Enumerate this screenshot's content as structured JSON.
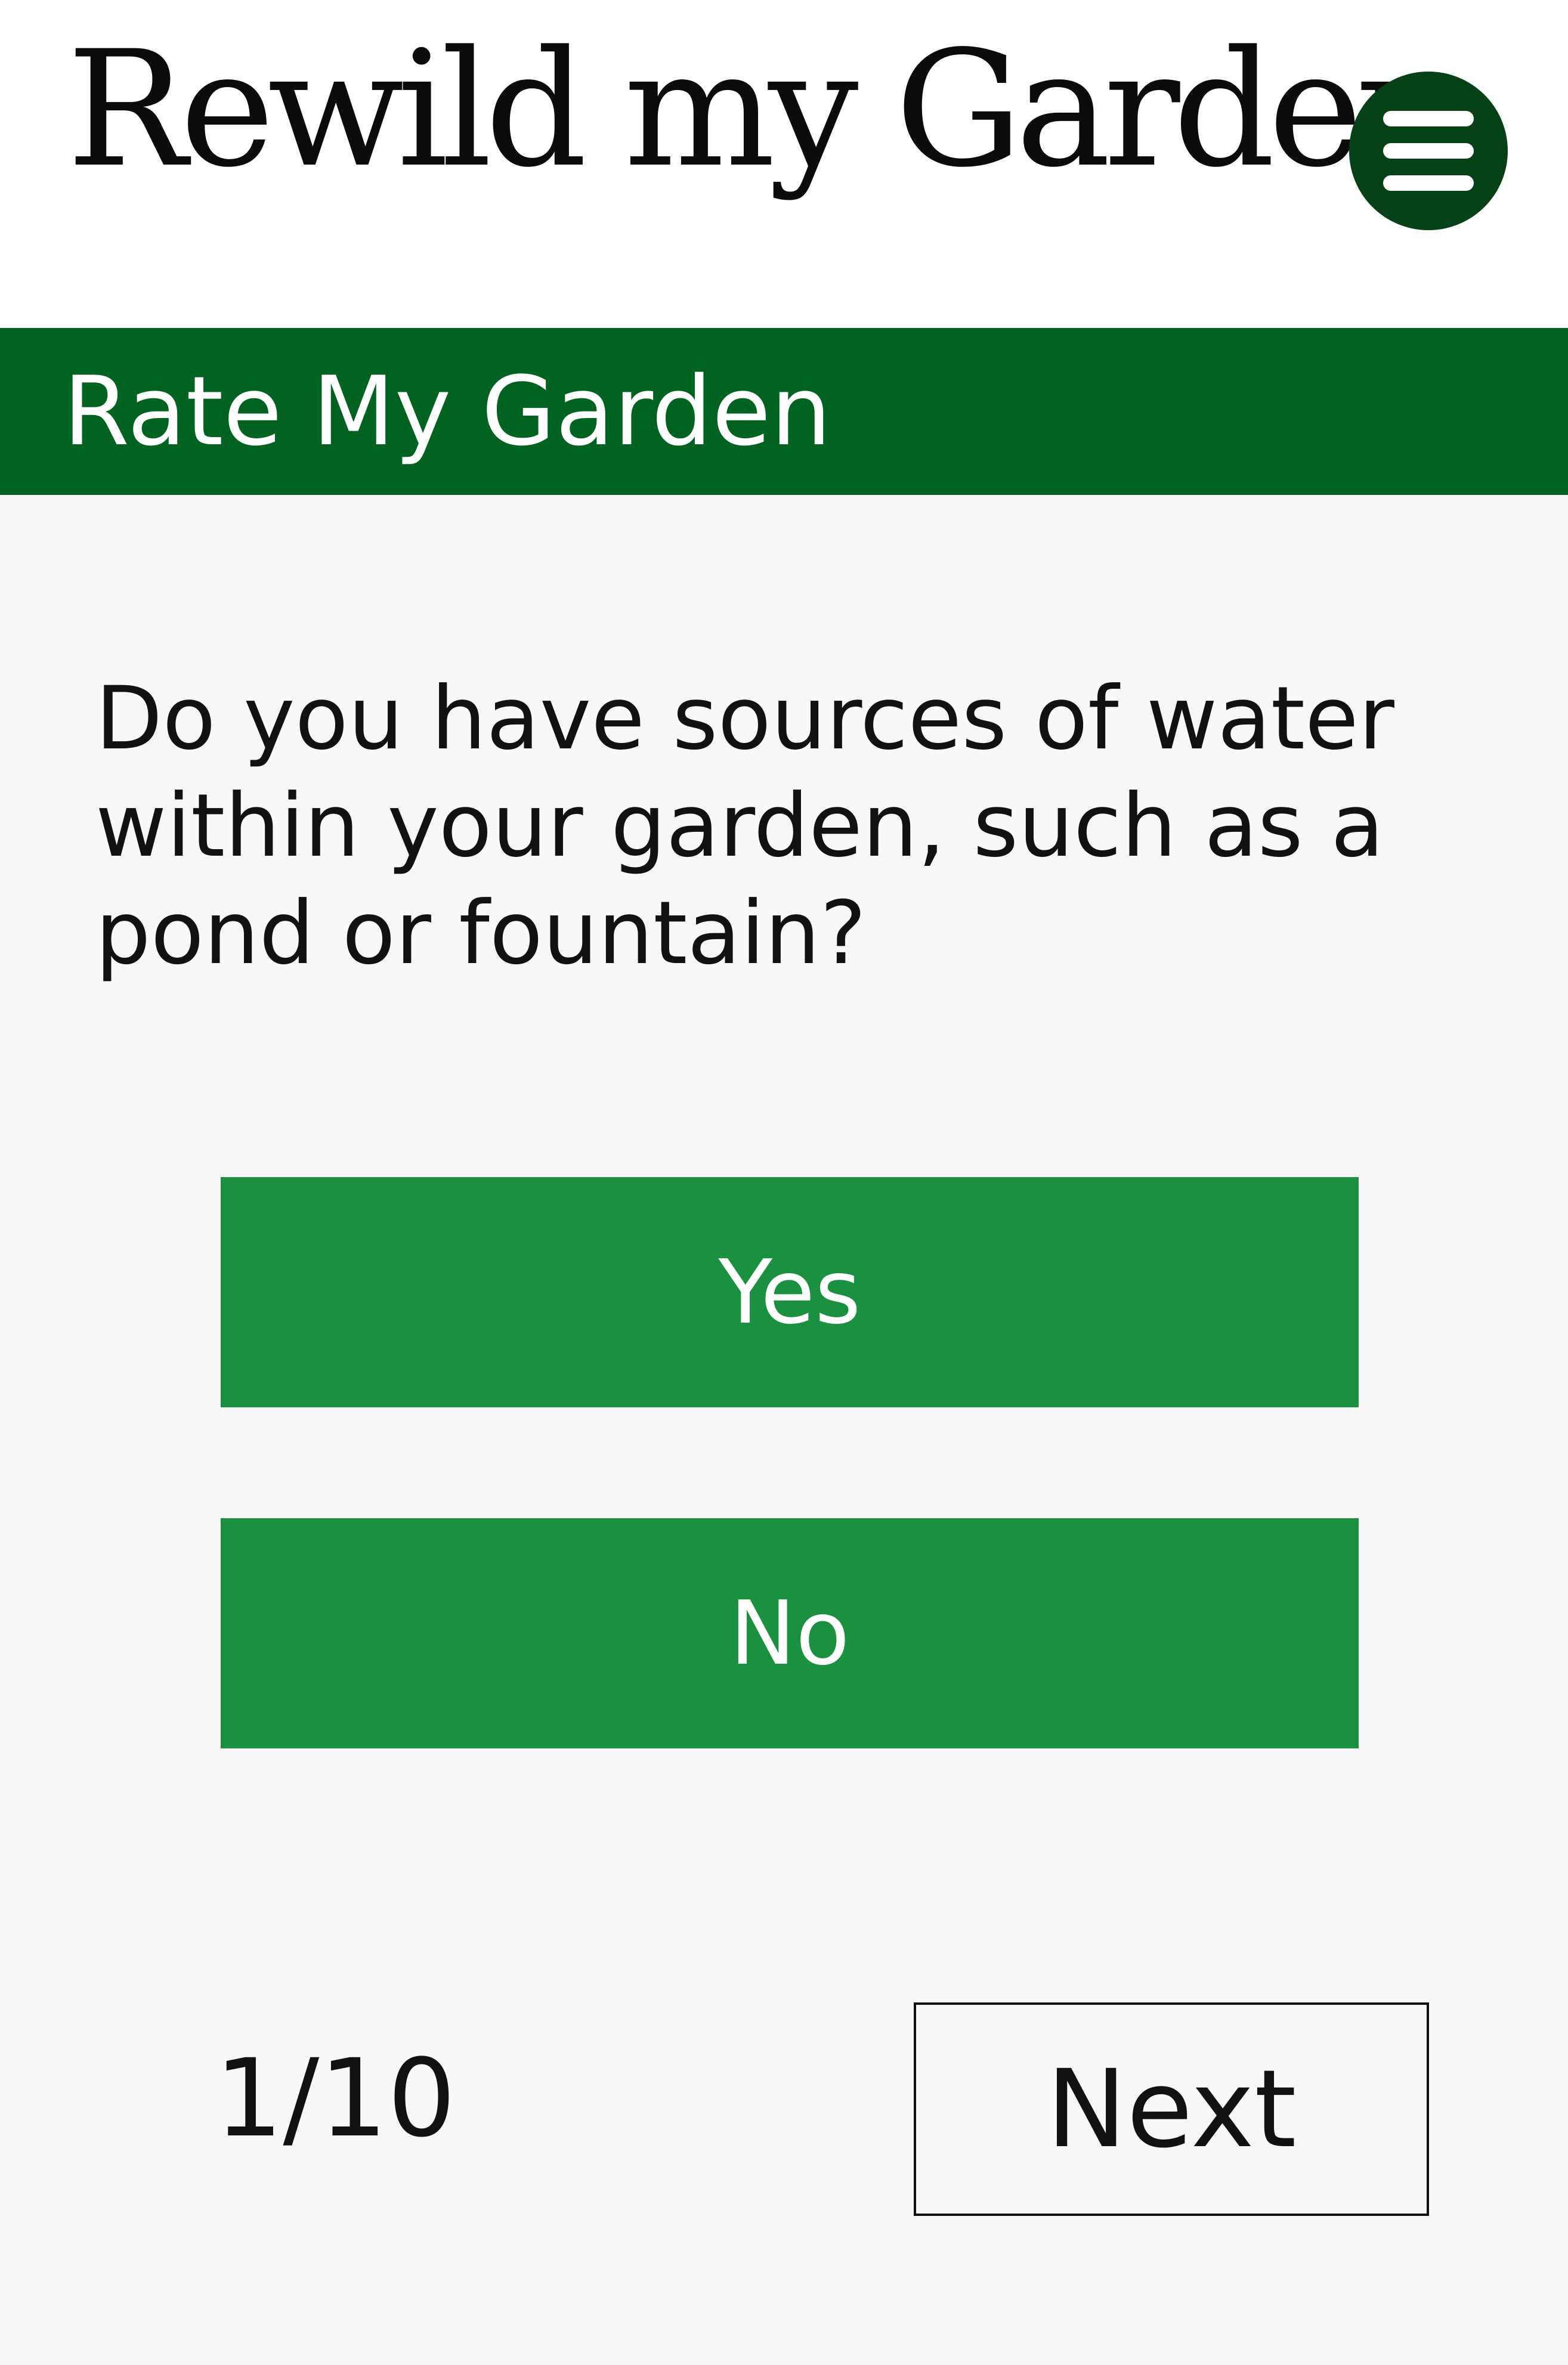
{
  "header": {
    "logo_text": "Rewild my Garden",
    "menu_icon": "hamburger-menu-icon"
  },
  "banner": {
    "title": "Rate My Garden"
  },
  "quiz": {
    "question": "Do you have sources of water within your garden, such as a pond or fountain?",
    "answers": [
      {
        "label": "Yes"
      },
      {
        "label": "No"
      }
    ],
    "progress_text": "1/10",
    "next_label": "Next"
  },
  "colors": {
    "page_background": "#f8f8f8",
    "header_background": "#ffffff",
    "banner_background": "#026221",
    "menu_button": "#064017",
    "answer_button": "#1b9040",
    "text": "#111111"
  }
}
